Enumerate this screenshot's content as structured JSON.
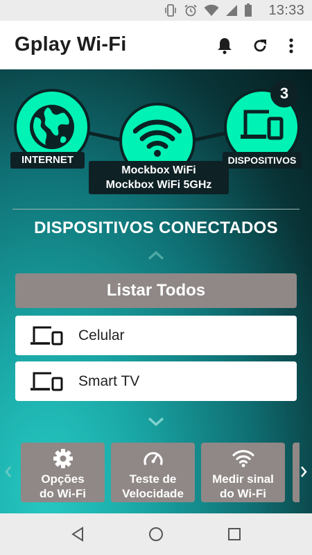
{
  "status_bar": {
    "time": "13:33",
    "icons": [
      "vibrate-icon",
      "alarm-icon",
      "wifi-icon",
      "cell-signal-icon",
      "battery-icon"
    ]
  },
  "app_bar": {
    "title": "Gplay Wi-Fi",
    "actions": [
      "bell-icon",
      "refresh-icon",
      "more-vert-icon"
    ]
  },
  "network": {
    "internet_label": "INTERNET",
    "wifi_name_1": "Mockbox WiFi",
    "wifi_name_2": "Mockbox WiFi 5GHz",
    "devices_label": "DISPOSITIVOS",
    "devices_count": "3"
  },
  "section": {
    "title": "DISPOSITIVOS CONECTADOS"
  },
  "list_all_label": "Listar Todos",
  "devices": [
    {
      "label": "Celular",
      "icon": "devices-icon"
    },
    {
      "label": "Smart TV",
      "icon": "devices-icon"
    }
  ],
  "tiles": [
    {
      "line1": "Opções",
      "line2": "do Wi-Fi",
      "icon": "gear-icon"
    },
    {
      "line1": "Teste de",
      "line2": "Velocidade",
      "icon": "speedometer-icon"
    },
    {
      "line1": "Medir sinal",
      "line2": "do Wi-Fi",
      "icon": "wifi-icon"
    }
  ],
  "colors": {
    "accent": "#00f2b4",
    "dark": "#0e2125",
    "tile": "#8f8886"
  }
}
